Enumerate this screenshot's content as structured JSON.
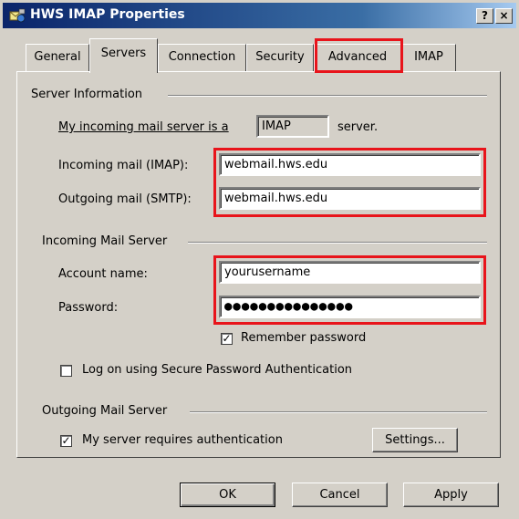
{
  "window": {
    "title": "HWS IMAP Properties",
    "help_button": "?",
    "close_button": "×"
  },
  "tabs": [
    {
      "label": "General"
    },
    {
      "label": "Servers"
    },
    {
      "label": "Connection"
    },
    {
      "label": "Security"
    },
    {
      "label": "Advanced"
    },
    {
      "label": "IMAP"
    }
  ],
  "server_info": {
    "group_label": "Server Information",
    "incoming_type_prefix": "My incoming mail server is a",
    "incoming_type_value": "IMAP",
    "incoming_type_suffix": "server.",
    "incoming_label": "Incoming mail (IMAP):",
    "incoming_value": "webmail.hws.edu",
    "outgoing_label": "Outgoing mail (SMTP):",
    "outgoing_value": "webmail.hws.edu"
  },
  "incoming_server": {
    "group_label": "Incoming Mail Server",
    "account_label": "Account name:",
    "account_value": "yourusername",
    "password_label": "Password:",
    "password_value": "●●●●●●●●●●●●●●●",
    "remember_label": "Remember password",
    "remember_checked": true,
    "spa_label": "Log on using Secure Password Authentication",
    "spa_checked": false
  },
  "outgoing_server": {
    "group_label": "Outgoing Mail Server",
    "auth_label": "My server requires authentication",
    "auth_checked": true,
    "settings_button": "Settings..."
  },
  "footer": {
    "ok": "OK",
    "cancel": "Cancel",
    "apply": "Apply"
  },
  "colors": {
    "highlight": "#e8141b",
    "titlebar": "#0a246a",
    "face": "#d4d0c8"
  }
}
